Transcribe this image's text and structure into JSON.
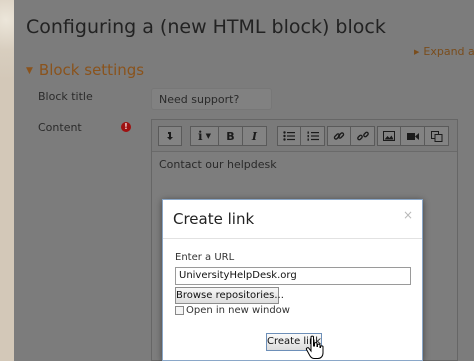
{
  "page": {
    "title": "Configuring a (new HTML block) block",
    "expand_all": "Expand all"
  },
  "section": {
    "heading": "Block settings"
  },
  "form": {
    "block_title_label": "Block title",
    "block_title_value": "Need support?",
    "content_label": "Content",
    "required_icon": "exclamation-circle-icon",
    "content_text": "Contact our helpdesk"
  },
  "toolbar": {
    "buttons": [
      "collapse-toolbar-icon",
      "info-paragraph-style-icon",
      "bold-icon",
      "italic-icon",
      "unordered-list-icon",
      "ordered-list-icon",
      "link-icon",
      "unlink-icon",
      "image-icon",
      "media-icon",
      "manage-files-icon"
    ],
    "bold_label": "B",
    "italic_label": "I"
  },
  "dialog": {
    "title": "Create link",
    "close": "×",
    "url_label": "Enter a URL",
    "url_value": "UniversityHelpDesk.org",
    "browse_label": "Browse repositories...",
    "new_window_label": "Open in new window",
    "new_window_checked": false,
    "create_button": "Create link"
  },
  "colors": {
    "section_heading": "#8a531c",
    "required_icon": "#9e1111",
    "dialog_border": "#8aa7c8"
  }
}
